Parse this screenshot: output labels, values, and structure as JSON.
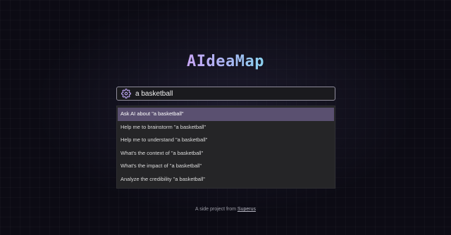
{
  "app": {
    "title": "AIdeaMap"
  },
  "search": {
    "value": "a basketball",
    "icon": "settings-gear-icon"
  },
  "suggestions": [
    {
      "label": "Ask AI about \"a basketball\"",
      "active": true
    },
    {
      "label": "Help me to brainstorm \"a basketball\"",
      "active": false
    },
    {
      "label": "Help me to understand \"a basketball\"",
      "active": false
    },
    {
      "label": "What's the context of \"a basketball\"",
      "active": false
    },
    {
      "label": "What's the impact of \"a basketball\"",
      "active": false
    },
    {
      "label": "Analyze the credibility \"a basketball\"",
      "active": false
    }
  ],
  "footer": {
    "text": "A side project from",
    "link_label": "Superus"
  },
  "colors": {
    "background": "#0c0b14",
    "accent_gradient_start": "#c8a6f5",
    "accent_gradient_end": "#8ad2ef",
    "active_suggestion": "#5a5070"
  }
}
